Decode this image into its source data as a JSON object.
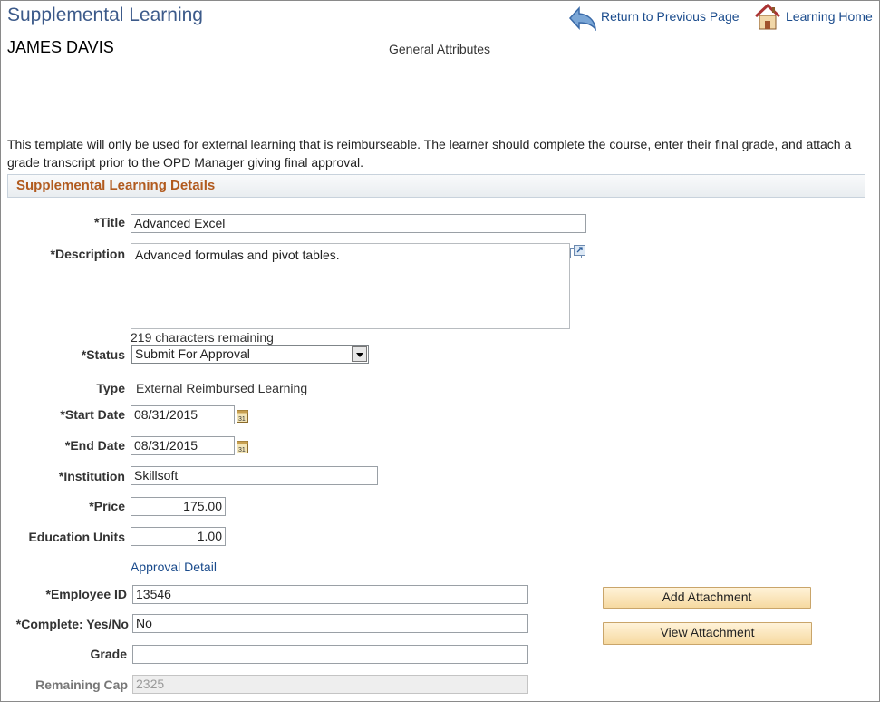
{
  "header": {
    "title": "Supplemental Learning",
    "return_link": "Return to Previous Page",
    "home_link": "Learning Home",
    "learner_name": "JAMES DAVIS",
    "subtitle": "General Attributes"
  },
  "intro_text": "This template will only be used for external learning that is reimburseable. The learner should complete the course, enter their final grade, and attach a grade transcript prior to the OPD Manager giving final approval.",
  "section": {
    "title": "Supplemental Learning Details"
  },
  "fields": {
    "title": {
      "label": "*Title",
      "value": "Advanced Excel"
    },
    "description": {
      "label": "*Description",
      "value": "Advanced formulas and pivot tables.",
      "remaining": "219 characters remaining"
    },
    "status": {
      "label": "*Status",
      "value": "Submit For Approval"
    },
    "type": {
      "label": "Type",
      "value": "External Reimbursed Learning"
    },
    "start_date": {
      "label": "*Start Date",
      "value": "08/31/2015"
    },
    "end_date": {
      "label": "*End Date",
      "value": "08/31/2015"
    },
    "institution": {
      "label": "*Institution",
      "value": "Skillsoft"
    },
    "price": {
      "label": "*Price",
      "value": "175.00"
    },
    "education_units": {
      "label": "Education Units",
      "value": "1.00"
    },
    "approval_detail": {
      "label": "Approval Detail"
    },
    "employee_id": {
      "label": "*Employee ID",
      "value": "13546"
    },
    "complete": {
      "label": "*Complete: Yes/No",
      "value": "No"
    },
    "grade": {
      "label": "Grade",
      "value": ""
    },
    "remaining_cap": {
      "label": "Remaining Cap",
      "value": "2325"
    }
  },
  "buttons": {
    "add_attachment": "Add Attachment",
    "view_attachment": "View Attachment"
  },
  "icons": {
    "return": "return-arrow-icon",
    "home": "house-icon",
    "expand": "expand-textarea-icon",
    "calendar": "calendar-icon"
  }
}
